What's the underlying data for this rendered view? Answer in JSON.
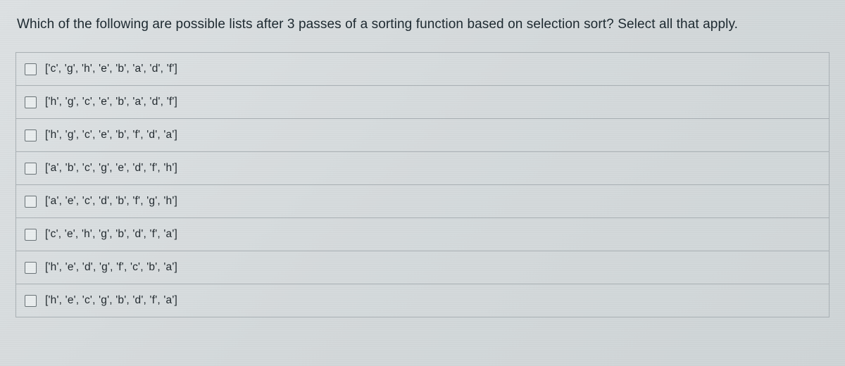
{
  "question": "Which of the following are possible lists after 3 passes of a sorting function based on selection sort? Select all that apply.",
  "options": [
    {
      "label": "['c', 'g', 'h', 'e', 'b', 'a', 'd', 'f']"
    },
    {
      "label": "['h', 'g', 'c', 'e', 'b', 'a', 'd', 'f']"
    },
    {
      "label": "['h', 'g', 'c', 'e', 'b', 'f', 'd', 'a']"
    },
    {
      "label": "['a', 'b', 'c', 'g', 'e', 'd', 'f', 'h']"
    },
    {
      "label": "['a', 'e', 'c', 'd', 'b', 'f', 'g', 'h']"
    },
    {
      "label": "['c', 'e', 'h', 'g', 'b', 'd', 'f', 'a']"
    },
    {
      "label": "['h', 'e', 'd', 'g', 'f', 'c', 'b', 'a']"
    },
    {
      "label": "['h', 'e', 'c', 'g', 'b', 'd', 'f', 'a']"
    }
  ]
}
